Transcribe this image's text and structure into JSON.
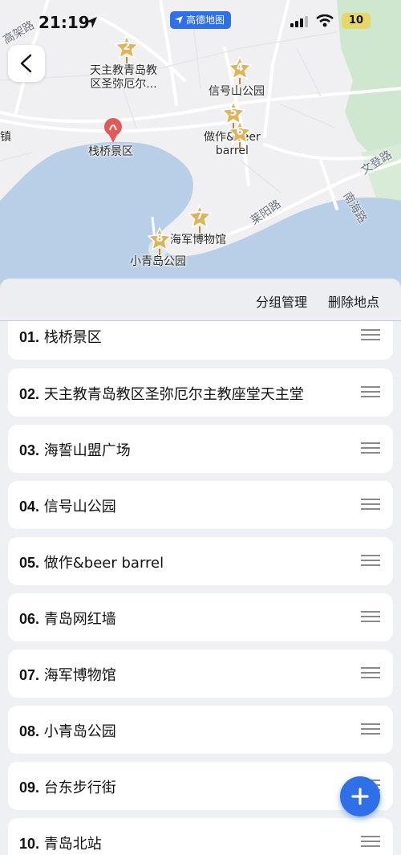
{
  "status_bar": {
    "time": "21:19",
    "app_badge": "高德地图",
    "battery": "10"
  },
  "map": {
    "places": {
      "catholic": "天主教青岛教\n区圣弥厄尔...",
      "xinhao": "信号山公园",
      "zuozuo": "做作&beer\nbarrel",
      "zhanqiao": "栈桥景区",
      "navy": "海军博物馆",
      "xiaoqingdao": "小青岛公园",
      "zhen": "镇",
      "gaojia": "高架路"
    },
    "roads": {
      "laiyang": "莱阳路",
      "wendeng": "文登路",
      "nanhai": "南海路"
    },
    "markers": [
      "2",
      "4",
      "5",
      "6",
      "7",
      "8"
    ]
  },
  "actions": {
    "group_manage": "分组管理",
    "delete_places": "删除地点"
  },
  "items": [
    {
      "num": "01.",
      "name": "栈桥景区"
    },
    {
      "num": "02.",
      "name": "天主教青岛教区圣弥厄尔主教座堂天主堂"
    },
    {
      "num": "03.",
      "name": "海誓山盟广场"
    },
    {
      "num": "04.",
      "name": "信号山公园"
    },
    {
      "num": "05.",
      "name": "做作&beer barrel"
    },
    {
      "num": "06.",
      "name": "青岛网红墙"
    },
    {
      "num": "07.",
      "name": "海军博物馆"
    },
    {
      "num": "08.",
      "name": "小青岛公园"
    },
    {
      "num": "09.",
      "name": "台东步行街"
    },
    {
      "num": "10.",
      "name": "青岛北站"
    }
  ],
  "colors": {
    "accent": "#2f6fe8",
    "water": "#b9cfe8",
    "marker": "#e0b35a",
    "park": "#cfe6cf"
  },
  "icons": [
    "back-chevron-icon",
    "location-arrow-icon",
    "signal-icon",
    "wifi-icon",
    "battery-icon",
    "drag-handle-icon",
    "plus-icon",
    "scenic-pin-icon",
    "star-marker-icon"
  ]
}
